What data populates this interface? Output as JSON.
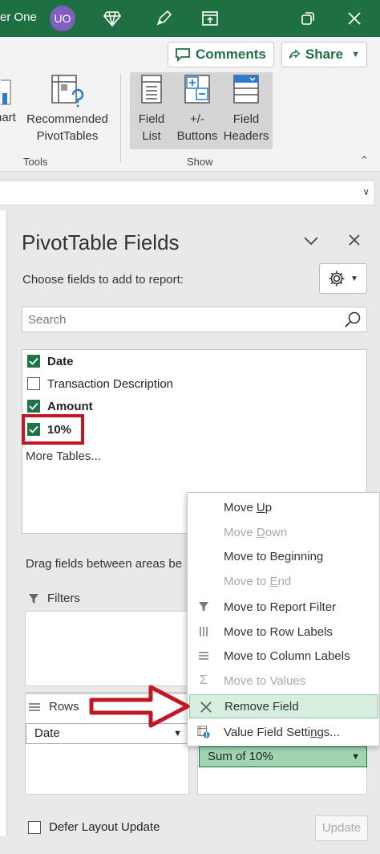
{
  "titlebar": {
    "user_name": "er One",
    "avatar_initials": "UO",
    "color": "#1e6f42"
  },
  "ribbon": {
    "comments_label": "Comments",
    "share_label": "Share",
    "chart_partial_label": "hart",
    "recommended_line1": "Recommended",
    "recommended_line2": "PivotTables",
    "tools_label": "Tools",
    "field_list_line1": "Field",
    "field_list_line2": "List",
    "buttons_line1": "+/-",
    "buttons_line2": "Buttons",
    "field_headers_line1": "Field",
    "field_headers_line2": "Headers",
    "show_label": "Show"
  },
  "pane": {
    "title": "PivotTable Fields",
    "choose_text": "Choose fields to add to report:",
    "search_placeholder": "Search",
    "fields": [
      {
        "label": "Date",
        "checked": true,
        "bold": true
      },
      {
        "label": "Transaction Description",
        "checked": false,
        "bold": false
      },
      {
        "label": "Amount",
        "checked": true,
        "bold": true
      },
      {
        "label": "10%",
        "checked": true,
        "bold": true
      }
    ],
    "more_tables": "More Tables...",
    "drag_text": "Drag fields between areas be",
    "filters_label": "Filters",
    "rows_label": "Rows",
    "rows_value": "Date",
    "values_value": "Sum of 10%",
    "defer_label": "Defer Layout Update",
    "update_label": "Update"
  },
  "context_menu": {
    "items": [
      {
        "pre": "Move ",
        "u": "U",
        "post": "p",
        "disabled": false,
        "icon": ""
      },
      {
        "pre": "Move ",
        "u": "D",
        "post": "own",
        "disabled": true,
        "icon": ""
      },
      {
        "pre": "Move to Be",
        "u": "g",
        "post": "inning",
        "disabled": false,
        "icon": ""
      },
      {
        "pre": "Move to ",
        "u": "E",
        "post": "nd",
        "disabled": true,
        "icon": ""
      },
      {
        "pre": "Move to Report Filter",
        "u": "",
        "post": "",
        "disabled": false,
        "icon": "filter-icon"
      },
      {
        "pre": "Move to Row Labels",
        "u": "",
        "post": "",
        "disabled": false,
        "icon": "row-labels-icon"
      },
      {
        "pre": "Move to Column Labels",
        "u": "",
        "post": "",
        "disabled": false,
        "icon": "column-labels-icon"
      },
      {
        "pre": "Move to Values",
        "u": "",
        "post": "",
        "disabled": true,
        "icon": "sigma-icon"
      },
      {
        "pre": "Remove Field",
        "u": "",
        "post": "",
        "disabled": false,
        "icon": "close-x-icon",
        "active": true
      },
      {
        "pre": "Value Field Setti",
        "u": "n",
        "post": "gs...",
        "disabled": false,
        "icon": "value-settings-icon"
      }
    ]
  },
  "colors": {
    "accent": "#217346",
    "highlight": "#c01722",
    "active_item": "#d6eedd"
  }
}
